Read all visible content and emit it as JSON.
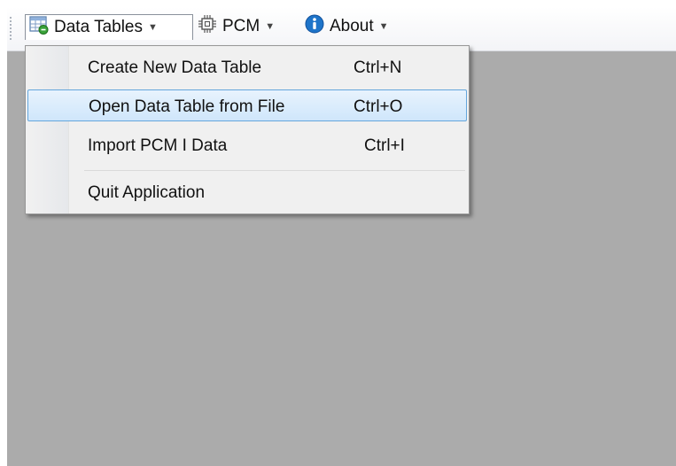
{
  "toolbar": {
    "data_tables_label": "Data Tables",
    "pcm_label": "PCM",
    "about_label": "About"
  },
  "menu": {
    "items": [
      {
        "label": "Create New Data Table",
        "shortcut": "Ctrl+N"
      },
      {
        "label": "Open Data Table from File",
        "shortcut": "Ctrl+O"
      },
      {
        "label": "Import PCM I Data",
        "shortcut": "Ctrl+I"
      },
      {
        "label": "Quit Application",
        "shortcut": ""
      }
    ]
  },
  "colors": {
    "content_background": "#ababab",
    "menu_highlight_border": "#64a6dc",
    "info_icon": "#1e74c9"
  },
  "icons": [
    "grid-table-icon",
    "chip-icon",
    "info-icon",
    "chevron-down-icon"
  ]
}
